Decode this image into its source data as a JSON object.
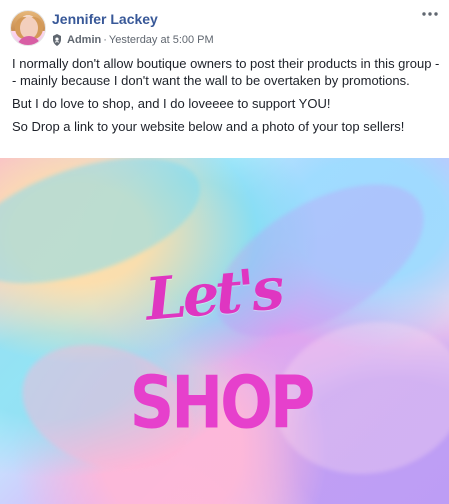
{
  "post": {
    "author": "Jennifer Lackey",
    "role": "Admin",
    "separator": "·",
    "timestamp": "Yesterday at 5:00 PM",
    "paragraphs": [
      "I normally don't allow boutique owners to post their products in this group -- mainly because I don't want the wall to be overtaken by promotions.",
      "But I do love to shop, and I do loveeee to support YOU!",
      "So Drop a link to your website below and a photo of your top sellers!"
    ],
    "image_text": {
      "top": "Let's",
      "bottom": "SHOP"
    }
  },
  "icons": {
    "avatar": "profile-avatar",
    "role": "shield-icon",
    "menu": "more-options-icon"
  },
  "colors": {
    "author": "#385898",
    "meta": "#606770",
    "image_pink": "#e640cc"
  }
}
